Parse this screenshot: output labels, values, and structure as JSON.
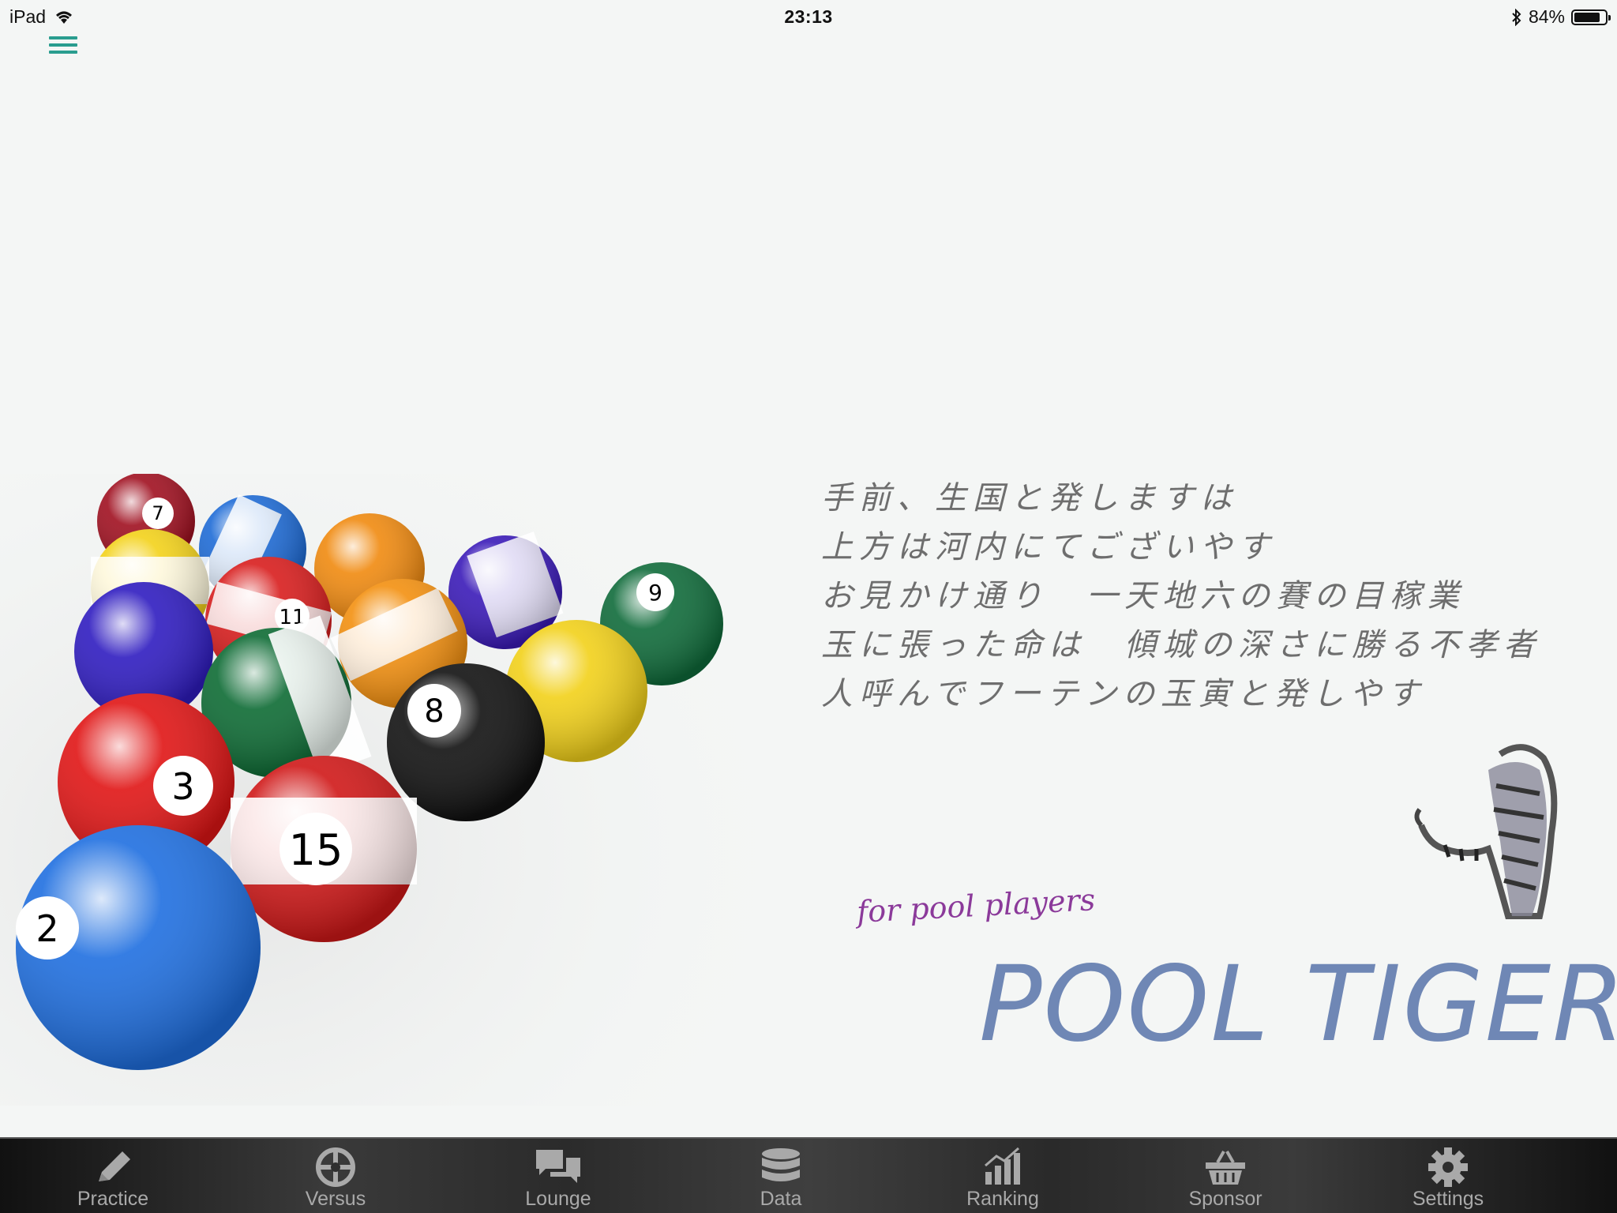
{
  "status_bar": {
    "device": "iPad",
    "time": "23:13",
    "battery": "84%"
  },
  "poem": {
    "lines": [
      "手前、生国と発しますは",
      "上方は河内にてございやす",
      "お見かけ通り　一天地六の賽の目稼業",
      "玉に張った命は　傾城の深さに勝る不孝者",
      "人呼んでフーテンの玉寅と発しやす"
    ]
  },
  "branding": {
    "tagline": "for pool players",
    "title": "POOL TIGER"
  },
  "tabs": [
    {
      "label": "Practice",
      "icon": "pencil-icon"
    },
    {
      "label": "Versus",
      "icon": "crosshair-icon"
    },
    {
      "label": "Lounge",
      "icon": "chat-icon"
    },
    {
      "label": "Data",
      "icon": "database-icon"
    },
    {
      "label": "Ranking",
      "icon": "bar-chart-icon"
    },
    {
      "label": "Sponsor",
      "icon": "basket-icon"
    },
    {
      "label": "Settings",
      "icon": "gear-icon"
    }
  ],
  "colors": {
    "menu_accent": "#2a9d8f",
    "title": "#6f87b5",
    "tagline": "#8b3a9a"
  }
}
